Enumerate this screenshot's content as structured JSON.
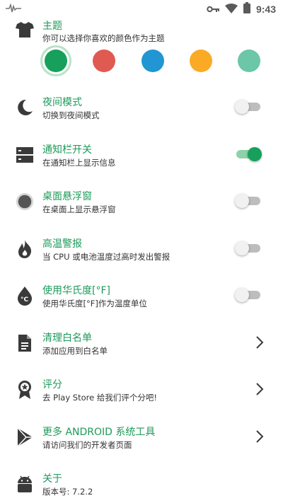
{
  "status_bar": {
    "time": "9:43"
  },
  "colors": {
    "accent": "#1e9a5a",
    "icon": "#3a3a3a"
  },
  "theme": {
    "title": "主题",
    "subtitle": "你可以选择你喜欢的颜色作为主题",
    "swatches": [
      "#16a05c",
      "#e05a52",
      "#2196d3",
      "#fbaa26",
      "#6cc6a8"
    ],
    "selected_index": 0
  },
  "settings": [
    {
      "title": "夜间模式",
      "subtitle": "切换到夜间模式",
      "icon": "moon-icon",
      "control": "toggle",
      "on": false
    },
    {
      "title": "通知栏开关",
      "subtitle": "在通知栏上显示信息",
      "icon": "notification-bar-icon",
      "control": "toggle",
      "on": true
    },
    {
      "title": "桌面悬浮窗",
      "subtitle": "在桌面上显示悬浮窗",
      "icon": "floating-window-icon",
      "control": "toggle",
      "on": false
    },
    {
      "title": "高温警报",
      "subtitle": "当 CPU 或电池温度过高时发出警报",
      "icon": "flame-icon",
      "control": "toggle",
      "on": false
    },
    {
      "title": "使用华氏度[°F]",
      "subtitle": "使用华氏度[°F]作为温度单位",
      "icon": "thermometer-celsius-icon",
      "control": "toggle",
      "on": false
    },
    {
      "title": "清理白名单",
      "subtitle": "添加应用到白名单",
      "icon": "document-icon",
      "control": "chevron"
    },
    {
      "title": "评分",
      "subtitle": "去 Play Store 给我们评个分吧!",
      "icon": "rating-badge-icon",
      "control": "chevron"
    },
    {
      "title": "更多 ANDROID 系统工具",
      "subtitle": "请访问我们的开发者页面",
      "icon": "play-store-icon",
      "control": "chevron"
    },
    {
      "title": "关于",
      "subtitle": "版本号: 7.2.2",
      "icon": "android-icon",
      "control": "none"
    }
  ]
}
